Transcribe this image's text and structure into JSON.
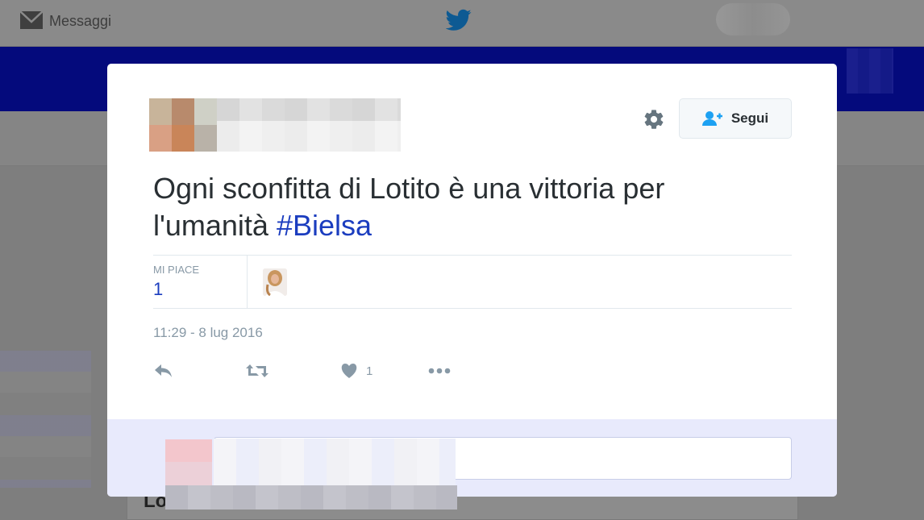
{
  "topbar": {
    "messages_label": "Messaggi",
    "messages_icon": "envelope-icon",
    "logo_icon": "twitter-bird-icon"
  },
  "background": {
    "card_title_fragment": "Lo"
  },
  "tweet": {
    "text": "Ogni sconfitta di Lotito è una vittoria per l'umanità ",
    "hashtag": "#Bielsa",
    "follow_label": "Segui",
    "stats": {
      "likes_label": "MI PIACE",
      "likes_value": "1"
    },
    "timestamp": "11:29 - 8 lug 2016",
    "actions": {
      "like_count": "1"
    }
  },
  "colors": {
    "link": "#1b3dbf",
    "text": "#292f33",
    "muted": "#8899a6",
    "header_blue": "#040a7c"
  }
}
